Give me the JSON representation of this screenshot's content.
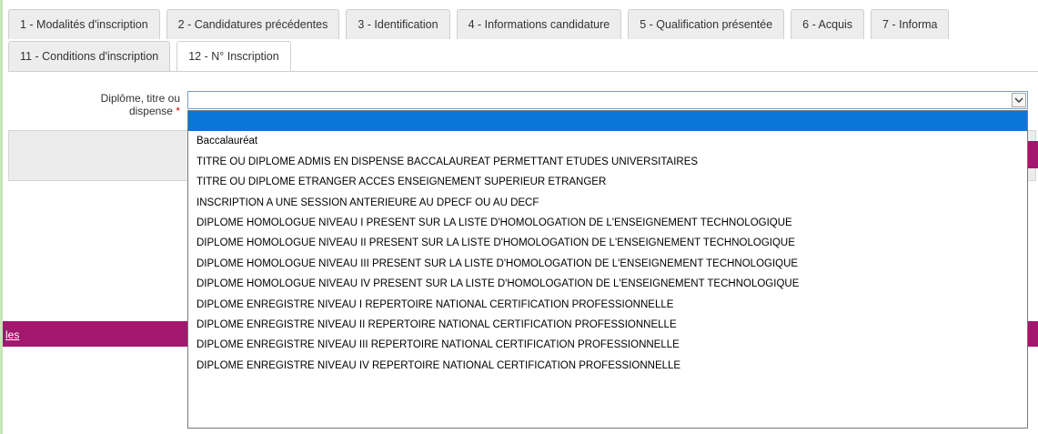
{
  "tabs_row1": [
    {
      "label": "1 - Modalités d'inscription"
    },
    {
      "label": "2 - Candidatures précédentes"
    },
    {
      "label": "3 - Identification"
    },
    {
      "label": "4 - Informations candidature"
    },
    {
      "label": "5 - Qualification présentée"
    },
    {
      "label": "6 - Acquis"
    },
    {
      "label": "7 - Informa"
    }
  ],
  "tabs_row2": [
    {
      "label": "11 - Conditions d'inscription"
    },
    {
      "label": "12 - N° Inscription"
    }
  ],
  "form": {
    "field_label_line1": "Diplôme, titre ou",
    "field_label_line2": "dispense",
    "required_marker": "*",
    "select_value": ""
  },
  "dropdown_options": [
    {
      "label": ""
    },
    {
      "label": "Baccalauréat"
    },
    {
      "label": "TITRE OU DIPLOME ADMIS EN DISPENSE BACCALAUREAT PERMETTANT ETUDES UNIVERSITAIRES"
    },
    {
      "label": "TITRE OU DIPLOME ETRANGER ACCES ENSEIGNEMENT SUPERIEUR ETRANGER"
    },
    {
      "label": "INSCRIPTION A UNE SESSION ANTERIEURE AU DPECF OU AU DECF"
    },
    {
      "label": "DIPLOME HOMOLOGUE NIVEAU I PRESENT SUR LA LISTE D'HOMOLOGATION DE L'ENSEIGNEMENT TECHNOLOGIQUE"
    },
    {
      "label": "DIPLOME HOMOLOGUE NIVEAU II PRESENT SUR LA LISTE D'HOMOLOGATION DE L'ENSEIGNEMENT TECHNOLOGIQUE"
    },
    {
      "label": "DIPLOME HOMOLOGUE NIVEAU III PRESENT SUR LA LISTE D'HOMOLOGATION DE L'ENSEIGNEMENT TECHNOLOGIQUE"
    },
    {
      "label": "DIPLOME HOMOLOGUE NIVEAU IV PRESENT SUR LA LISTE D'HOMOLOGATION DE L'ENSEIGNEMENT TECHNOLOGIQUE"
    },
    {
      "label": "DIPLOME ENREGISTRE NIVEAU I REPERTOIRE NATIONAL CERTIFICATION PROFESSIONNELLE"
    },
    {
      "label": "DIPLOME ENREGISTRE NIVEAU II REPERTOIRE NATIONAL CERTIFICATION PROFESSIONNELLE"
    },
    {
      "label": "DIPLOME ENREGISTRE NIVEAU III REPERTOIRE NATIONAL CERTIFICATION PROFESSIONNELLE"
    },
    {
      "label": "DIPLOME ENREGISTRE NIVEAU IV REPERTOIRE NATIONAL CERTIFICATION PROFESSIONNELLE"
    }
  ],
  "footer": {
    "link_text": "les"
  },
  "icons": {
    "select_arrow": "chevron-down-icon"
  },
  "colors": {
    "accent_magenta": "#a3176e",
    "selection_blue": "#0a76d9",
    "select_border": "#7a9cc6"
  }
}
